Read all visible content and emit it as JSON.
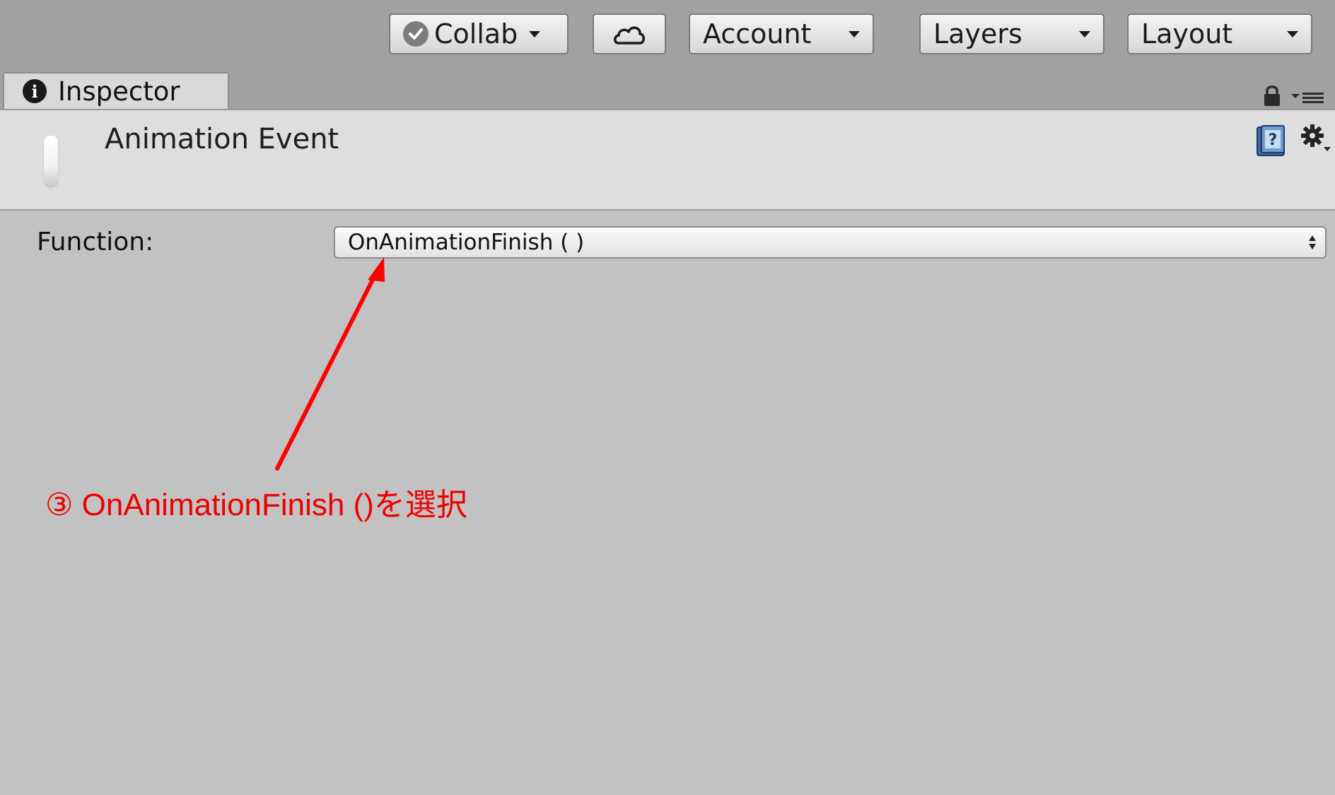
{
  "toolbar": {
    "collab_label": "Collab",
    "account_label": "Account",
    "layers_label": "Layers",
    "layout_label": "Layout"
  },
  "tab": {
    "label": "Inspector"
  },
  "header": {
    "title": "Animation Event"
  },
  "field": {
    "label": "Function:",
    "value": "OnAnimationFinish ( )"
  },
  "annotation": {
    "text": "③ OnAnimationFinish ()を選択",
    "color": "#ee0000"
  },
  "colors": {
    "background": "#a2a2a2",
    "panel": "#c2c2c2",
    "header": "#dedede",
    "annotation": "#ee0000"
  }
}
